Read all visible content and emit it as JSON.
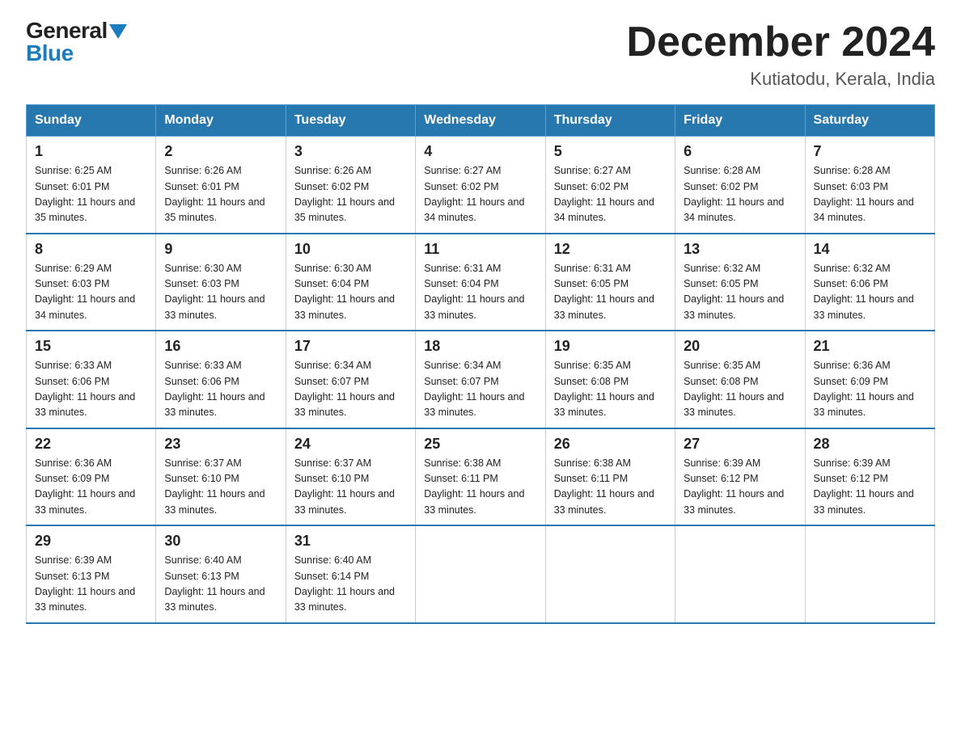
{
  "logo": {
    "general": "General",
    "blue": "Blue"
  },
  "header": {
    "month_year": "December 2024",
    "location": "Kutiatodu, Kerala, India"
  },
  "days_of_week": [
    "Sunday",
    "Monday",
    "Tuesday",
    "Wednesday",
    "Thursday",
    "Friday",
    "Saturday"
  ],
  "weeks": [
    [
      {
        "day": "1",
        "sunrise": "6:25 AM",
        "sunset": "6:01 PM",
        "daylight": "11 hours and 35 minutes."
      },
      {
        "day": "2",
        "sunrise": "6:26 AM",
        "sunset": "6:01 PM",
        "daylight": "11 hours and 35 minutes."
      },
      {
        "day": "3",
        "sunrise": "6:26 AM",
        "sunset": "6:02 PM",
        "daylight": "11 hours and 35 minutes."
      },
      {
        "day": "4",
        "sunrise": "6:27 AM",
        "sunset": "6:02 PM",
        "daylight": "11 hours and 34 minutes."
      },
      {
        "day": "5",
        "sunrise": "6:27 AM",
        "sunset": "6:02 PM",
        "daylight": "11 hours and 34 minutes."
      },
      {
        "day": "6",
        "sunrise": "6:28 AM",
        "sunset": "6:02 PM",
        "daylight": "11 hours and 34 minutes."
      },
      {
        "day": "7",
        "sunrise": "6:28 AM",
        "sunset": "6:03 PM",
        "daylight": "11 hours and 34 minutes."
      }
    ],
    [
      {
        "day": "8",
        "sunrise": "6:29 AM",
        "sunset": "6:03 PM",
        "daylight": "11 hours and 34 minutes."
      },
      {
        "day": "9",
        "sunrise": "6:30 AM",
        "sunset": "6:03 PM",
        "daylight": "11 hours and 33 minutes."
      },
      {
        "day": "10",
        "sunrise": "6:30 AM",
        "sunset": "6:04 PM",
        "daylight": "11 hours and 33 minutes."
      },
      {
        "day": "11",
        "sunrise": "6:31 AM",
        "sunset": "6:04 PM",
        "daylight": "11 hours and 33 minutes."
      },
      {
        "day": "12",
        "sunrise": "6:31 AM",
        "sunset": "6:05 PM",
        "daylight": "11 hours and 33 minutes."
      },
      {
        "day": "13",
        "sunrise": "6:32 AM",
        "sunset": "6:05 PM",
        "daylight": "11 hours and 33 minutes."
      },
      {
        "day": "14",
        "sunrise": "6:32 AM",
        "sunset": "6:06 PM",
        "daylight": "11 hours and 33 minutes."
      }
    ],
    [
      {
        "day": "15",
        "sunrise": "6:33 AM",
        "sunset": "6:06 PM",
        "daylight": "11 hours and 33 minutes."
      },
      {
        "day": "16",
        "sunrise": "6:33 AM",
        "sunset": "6:06 PM",
        "daylight": "11 hours and 33 minutes."
      },
      {
        "day": "17",
        "sunrise": "6:34 AM",
        "sunset": "6:07 PM",
        "daylight": "11 hours and 33 minutes."
      },
      {
        "day": "18",
        "sunrise": "6:34 AM",
        "sunset": "6:07 PM",
        "daylight": "11 hours and 33 minutes."
      },
      {
        "day": "19",
        "sunrise": "6:35 AM",
        "sunset": "6:08 PM",
        "daylight": "11 hours and 33 minutes."
      },
      {
        "day": "20",
        "sunrise": "6:35 AM",
        "sunset": "6:08 PM",
        "daylight": "11 hours and 33 minutes."
      },
      {
        "day": "21",
        "sunrise": "6:36 AM",
        "sunset": "6:09 PM",
        "daylight": "11 hours and 33 minutes."
      }
    ],
    [
      {
        "day": "22",
        "sunrise": "6:36 AM",
        "sunset": "6:09 PM",
        "daylight": "11 hours and 33 minutes."
      },
      {
        "day": "23",
        "sunrise": "6:37 AM",
        "sunset": "6:10 PM",
        "daylight": "11 hours and 33 minutes."
      },
      {
        "day": "24",
        "sunrise": "6:37 AM",
        "sunset": "6:10 PM",
        "daylight": "11 hours and 33 minutes."
      },
      {
        "day": "25",
        "sunrise": "6:38 AM",
        "sunset": "6:11 PM",
        "daylight": "11 hours and 33 minutes."
      },
      {
        "day": "26",
        "sunrise": "6:38 AM",
        "sunset": "6:11 PM",
        "daylight": "11 hours and 33 minutes."
      },
      {
        "day": "27",
        "sunrise": "6:39 AM",
        "sunset": "6:12 PM",
        "daylight": "11 hours and 33 minutes."
      },
      {
        "day": "28",
        "sunrise": "6:39 AM",
        "sunset": "6:12 PM",
        "daylight": "11 hours and 33 minutes."
      }
    ],
    [
      {
        "day": "29",
        "sunrise": "6:39 AM",
        "sunset": "6:13 PM",
        "daylight": "11 hours and 33 minutes."
      },
      {
        "day": "30",
        "sunrise": "6:40 AM",
        "sunset": "6:13 PM",
        "daylight": "11 hours and 33 minutes."
      },
      {
        "day": "31",
        "sunrise": "6:40 AM",
        "sunset": "6:14 PM",
        "daylight": "11 hours and 33 minutes."
      },
      null,
      null,
      null,
      null
    ]
  ]
}
